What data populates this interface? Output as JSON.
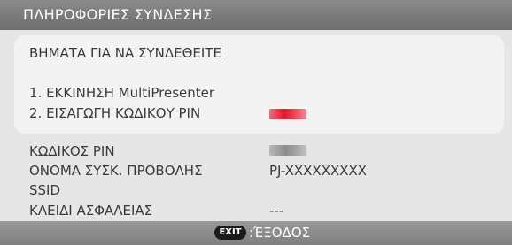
{
  "title": "ΠΛΗΡΟΦΟΡΙΕΣ ΣΥΝΔΕΣΗΣ",
  "steps": {
    "heading": "ΒΗΜΑΤΑ ΓΙΑ ΝΑ ΣΥΝΔΕΘΕΙΤΕ",
    "step1": "1. ΕΚΚΙΝΗΣΗ MultiPresenter",
    "step2": "2. ΕΙΣΑΓΩΓΗ ΚΩΔΙΚΟΥ PIN"
  },
  "info": {
    "pin_label": "ΚΩΔΙΚΟΣ PIN",
    "projector_name_label": "ΟΝΟΜΑ ΣΥΣΚ. ΠΡΟΒΟΛΗΣ",
    "projector_name_value": "PJ-XXXXXXXXX",
    "ssid_label": "SSID",
    "security_key_label": "ΚΛΕΙΔΙ ΑΣΦΑΛΕΙΑΣ",
    "security_key_value": "---"
  },
  "footer": {
    "exit_key": "EXIT",
    "exit_label": ":ΈΞΟΔΟΣ"
  },
  "colors": {
    "pin_highlight": "#e01a2e",
    "pin_masked": "#8c8c8c"
  }
}
